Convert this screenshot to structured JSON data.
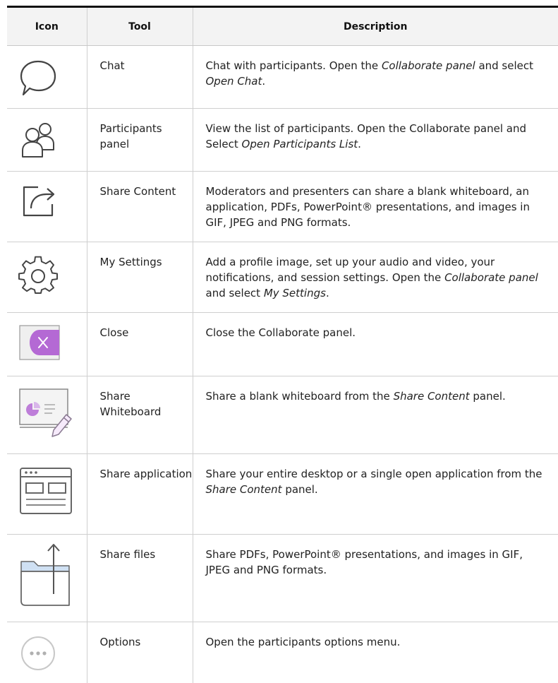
{
  "headers": {
    "icon": "Icon",
    "tool": "Tool",
    "description": "Description"
  },
  "rows": [
    {
      "icon": "chat-bubble-icon",
      "tool": "Chat",
      "desc": [
        {
          "t": "Chat with participants. Open the "
        },
        {
          "t": "Collaborate panel",
          "i": true
        },
        {
          "t": " and select "
        },
        {
          "t": "Open Chat",
          "i": true
        },
        {
          "t": "."
        }
      ]
    },
    {
      "icon": "participants-icon",
      "tool": "Participants panel",
      "desc": [
        {
          "t": "View the list of participants. Open the Collaborate panel and Select "
        },
        {
          "t": "Open Participants List",
          "i": true
        },
        {
          "t": "."
        }
      ]
    },
    {
      "icon": "share-content-icon",
      "tool": "Share Content",
      "desc": [
        {
          "t": "Moderators and presenters can share a blank whiteboard, an application, PDFs, PowerPoint® presentations, and images in GIF, JPEG and PNG formats."
        }
      ]
    },
    {
      "icon": "gear-icon",
      "tool": "My Settings",
      "desc": [
        {
          "t": "Add a profile image, set up your audio and video, your notifications, and session settings. Open the "
        },
        {
          "t": "Collaborate panel",
          "i": true
        },
        {
          "t": " and select "
        },
        {
          "t": "My Settings",
          "i": true
        },
        {
          "t": "."
        }
      ]
    },
    {
      "icon": "close-tab-icon",
      "tool": "Close",
      "desc": [
        {
          "t": "Close the Collaborate panel."
        }
      ]
    },
    {
      "icon": "whiteboard-icon",
      "tool": "Share Whiteboard",
      "desc": [
        {
          "t": "Share a blank whiteboard from the "
        },
        {
          "t": "Share Content",
          "i": true
        },
        {
          "t": " panel."
        }
      ]
    },
    {
      "icon": "application-window-icon",
      "tool": "Share application",
      "desc": [
        {
          "t": "Share your entire desktop or a single open application from the "
        },
        {
          "t": "Share Content",
          "i": true
        },
        {
          "t": " panel."
        }
      ]
    },
    {
      "icon": "folder-upload-icon",
      "tool": "Share files",
      "desc": [
        {
          "t": "Share PDFs, PowerPoint® presentations, and images in GIF, JPEG and PNG formats."
        }
      ]
    },
    {
      "icon": "more-options-icon",
      "tool": "Options",
      "desc": [
        {
          "t": "Open the participants options menu."
        }
      ]
    }
  ],
  "colors": {
    "accent": "#b469d4",
    "line": "#cfcfcf",
    "icon_stroke": "#444444",
    "header_bg": "#f3f3f3"
  }
}
